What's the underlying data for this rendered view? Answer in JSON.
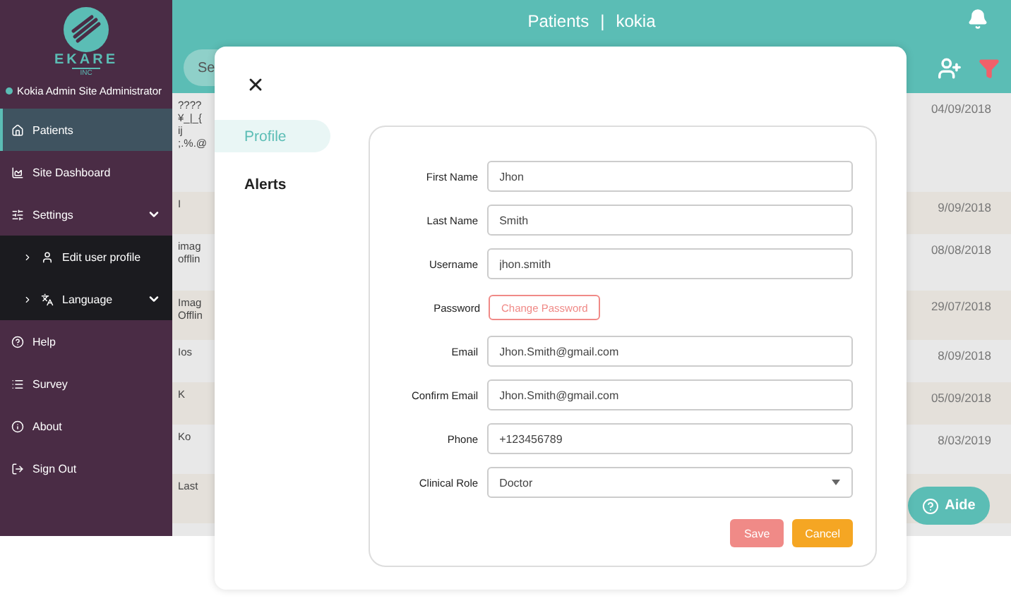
{
  "header": {
    "title": "Patients",
    "separator": "|",
    "site": "kokia"
  },
  "sidebar": {
    "logo": {
      "name": "EKARE",
      "sub": "INC"
    },
    "user": "Kokia Admin Site Administrator",
    "items": [
      {
        "label": "Patients",
        "kind": "home",
        "selected": true
      },
      {
        "label": "Site Dashboard",
        "kind": "chart",
        "selected": false
      },
      {
        "label": "Settings",
        "kind": "sliders",
        "selected": false,
        "expanded": true,
        "children": [
          {
            "label": "Edit user profile",
            "kind": "user",
            "selected": false
          },
          {
            "label": "Language",
            "kind": "language",
            "selected": false
          }
        ]
      },
      {
        "label": "Help",
        "kind": "help",
        "selected": false
      },
      {
        "label": "Survey",
        "kind": "list",
        "selected": false
      },
      {
        "label": "About",
        "kind": "info",
        "selected": false
      },
      {
        "label": "Sign Out",
        "kind": "signout",
        "selected": false
      }
    ]
  },
  "search": {
    "placeholder": "Se"
  },
  "table": {
    "rows": [
      {
        "name": [
          "????",
          "¥_|_{",
          "ij",
          ";.%.@"
        ],
        "date": "04/09/2018"
      },
      {
        "name": [
          "I"
        ],
        "date": "9/09/2018"
      },
      {
        "name": [
          "imag",
          "offlin"
        ],
        "date": "08/08/2018"
      },
      {
        "name": [
          "Imag",
          "Offlin"
        ],
        "date": "29/07/2018"
      },
      {
        "name": [
          "Ios"
        ],
        "date": "8/09/2018"
      },
      {
        "name": [
          "K"
        ],
        "date": "05/09/2018"
      },
      {
        "name": [
          "Ko"
        ],
        "date": "8/03/2019"
      },
      {
        "name": [
          "Last"
        ],
        "date": ""
      }
    ]
  },
  "help_button": {
    "label": "Aide"
  },
  "modal": {
    "tabs": [
      {
        "label": "Profile",
        "selected": true
      },
      {
        "label": "Alerts",
        "selected": false
      }
    ],
    "fields": [
      {
        "kind": "text",
        "label": "First Name",
        "value": "Jhon"
      },
      {
        "kind": "text",
        "label": "Last Name",
        "value": "Smith"
      },
      {
        "kind": "text",
        "label": "Username",
        "value": "jhon.smith"
      },
      {
        "kind": "button",
        "label": "Password",
        "value": "Change Password"
      },
      {
        "kind": "text",
        "label": "Email",
        "value": "Jhon.Smith@gmail.com"
      },
      {
        "kind": "text",
        "label": "Confirm Email",
        "value": "Jhon.Smith@gmail.com"
      },
      {
        "kind": "text",
        "label": "Phone",
        "value": "+123456789"
      },
      {
        "kind": "select",
        "label": "Clinical Role",
        "value": "Doctor"
      }
    ],
    "buttons": [
      {
        "kind": "save",
        "label": "Save"
      },
      {
        "kind": "cancel",
        "label": "Cancel"
      }
    ]
  }
}
